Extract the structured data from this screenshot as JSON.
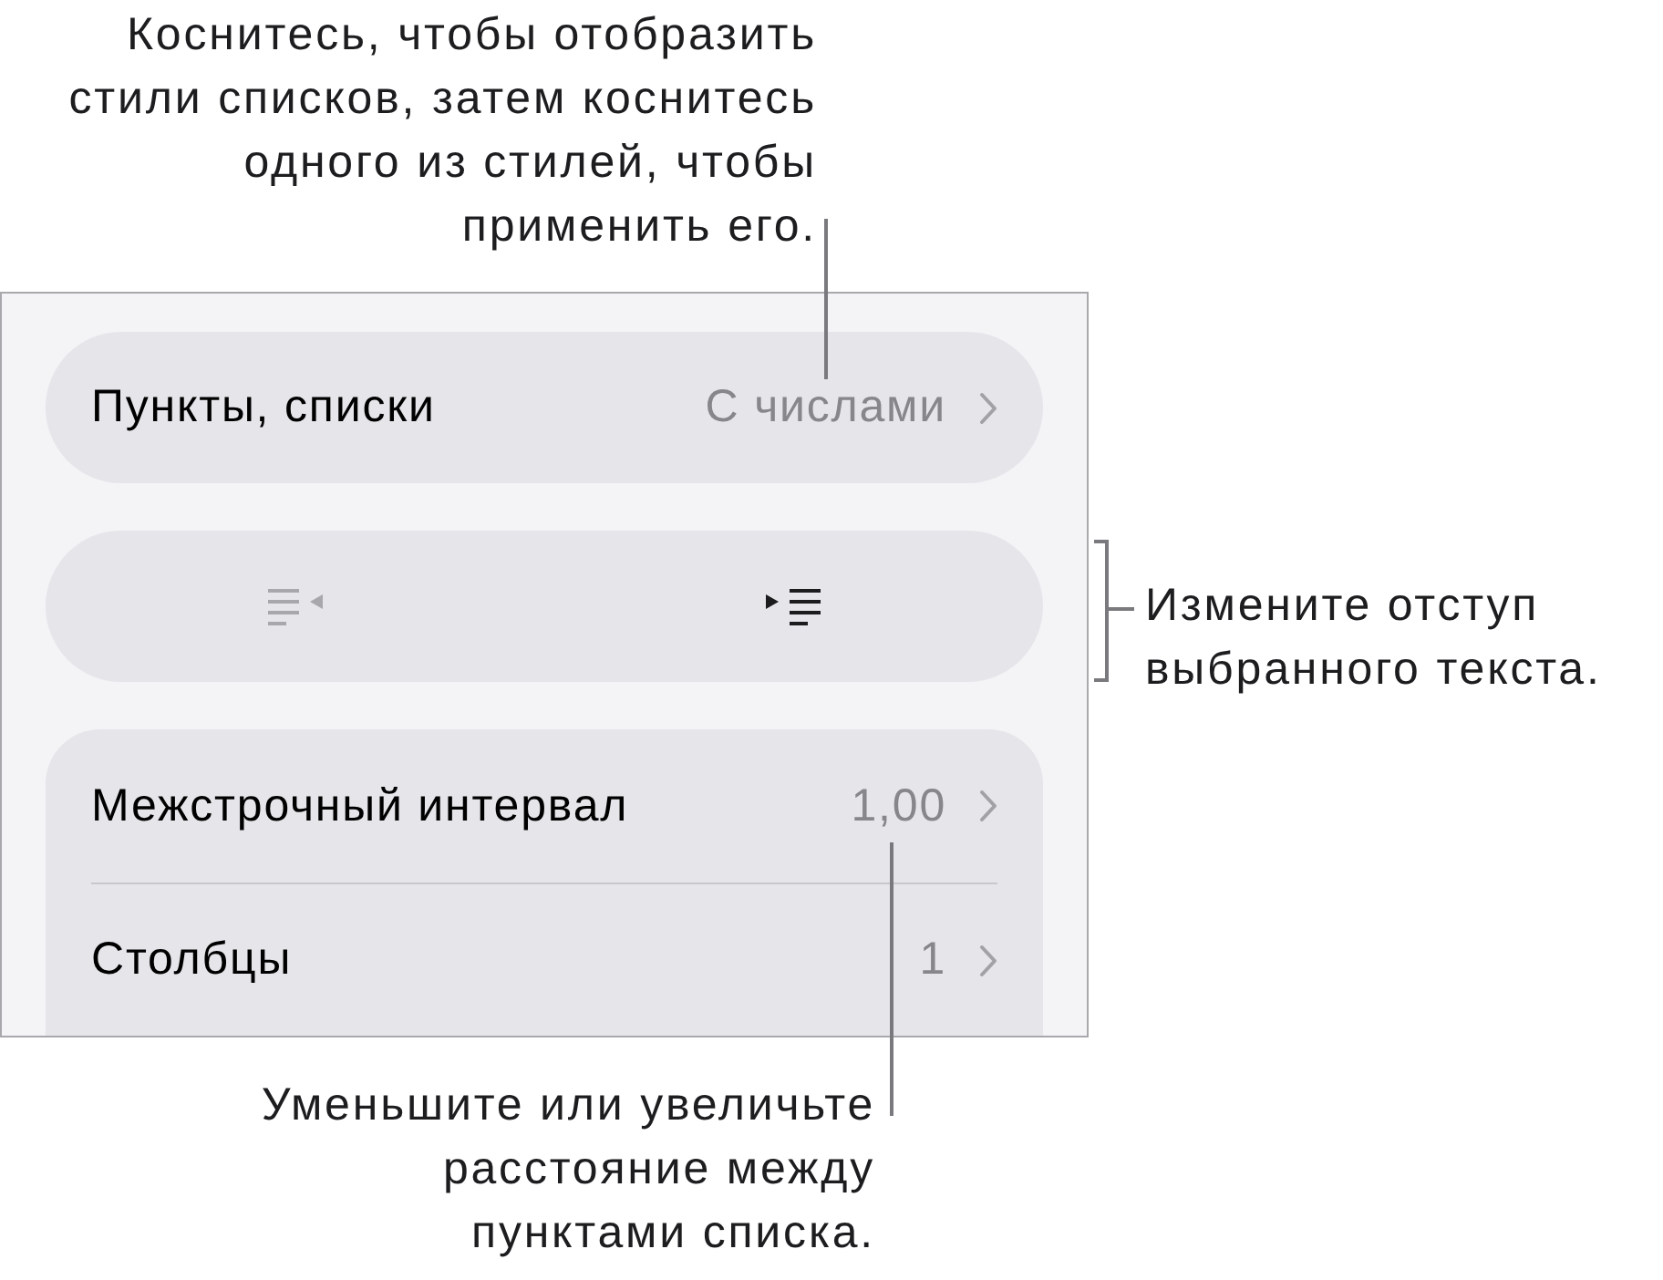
{
  "callouts": [
    {
      "text": "Коснитесь, чтобы отобразить\nстили списков, затем коснитесь\nодного из стилей, чтобы\nприменить его."
    },
    {
      "text": "Измените отступ\nвыбранного текста."
    },
    {
      "text": "Уменьшите или увеличьте\nрасстояние между\nпунктами списка."
    }
  ],
  "panel": {
    "list_row": {
      "label": "Пункты, списки",
      "value": "С числами"
    },
    "indent_buttons": [
      {
        "kind": "outdent",
        "disabled": true
      },
      {
        "kind": "indent",
        "disabled": false
      }
    ],
    "settings": [
      {
        "label": "Межстрочный интервал",
        "value": "1,00"
      },
      {
        "label": "Столбцы",
        "value": "1"
      }
    ]
  }
}
